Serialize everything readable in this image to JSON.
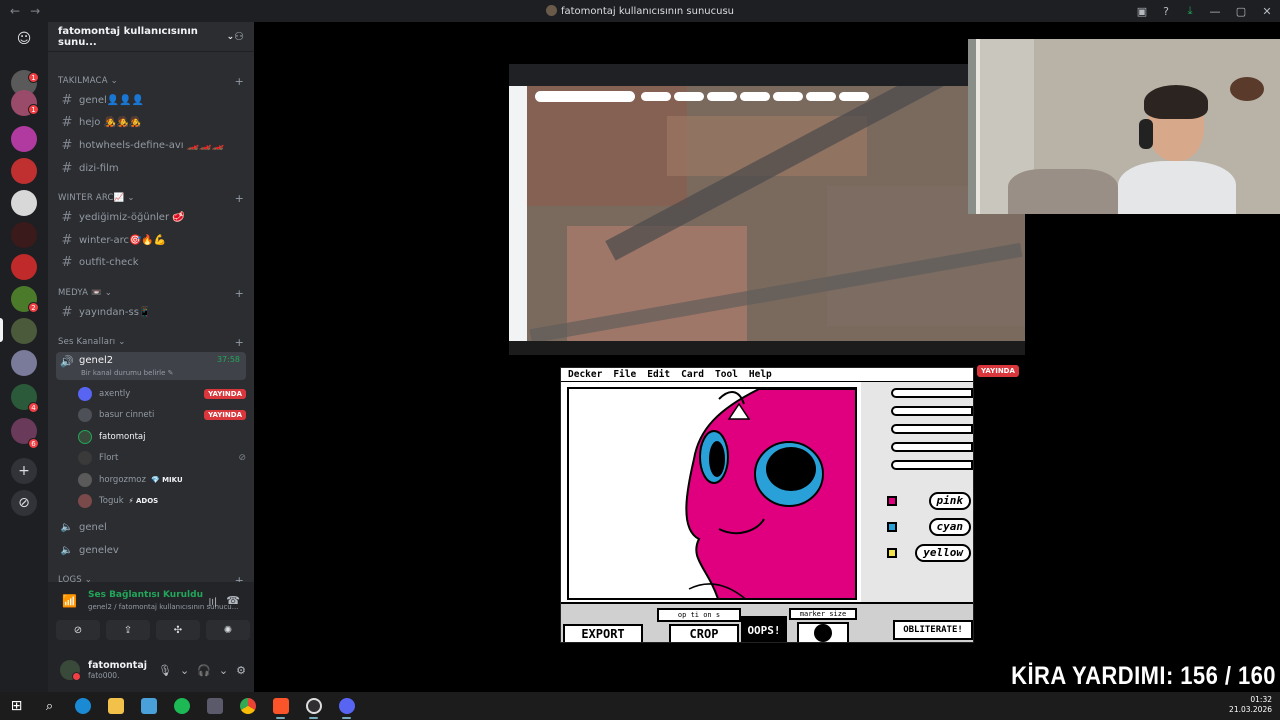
{
  "window": {
    "title": "fatomontaj kullanıcısının sunucusu",
    "nav_back": "←",
    "nav_forward": "→"
  },
  "server": {
    "name": "fatomontaj kullanıcısının sunu...",
    "badges": [
      "1",
      "1",
      "2",
      "4",
      "6"
    ]
  },
  "categories": [
    {
      "name": "TAKILMACA",
      "channels": [
        {
          "name": "genel👤👤👤"
        },
        {
          "name": "hejo 🧑‍🎤🧑‍🎤🧑‍🎤"
        },
        {
          "name": "hotwheels-define-avı 🏎️🏎️🏎️"
        },
        {
          "name": "dizi-film"
        }
      ]
    },
    {
      "name": "WINTER ARC📈",
      "channels": [
        {
          "name": "yediğimiz-öğünler 🥩"
        },
        {
          "name": "winter-arc🎯🔥💪"
        },
        {
          "name": "outfit-check"
        }
      ]
    },
    {
      "name": "MEDYA 📼",
      "channels": [
        {
          "name": "yayından-ss📱"
        }
      ]
    },
    {
      "name": "Ses Kanalları",
      "channels": []
    }
  ],
  "voice": {
    "active_channel": "genel2",
    "timer": "37:58",
    "status_prompt": "Bir kanal durumu belirle",
    "users": [
      {
        "name": "axently",
        "badge": "YAYINDA",
        "color": "#5865f2"
      },
      {
        "name": "basur cinneti",
        "badge": "YAYINDA",
        "color": "#4e5058"
      },
      {
        "name": "fatomontaj",
        "badge": "",
        "color": "#3a4a3a"
      },
      {
        "name": "Flort",
        "badge": "",
        "color": "#3a3a3a"
      },
      {
        "name": "horgozmoz",
        "badge": "",
        "tag": "💎 MIKU",
        "color": "#5a5a5a"
      },
      {
        "name": "Toguk",
        "badge": "",
        "tag": "⚡ ADOS",
        "color": "#7a4a4a"
      }
    ],
    "other_channels": [
      "genel",
      "genelev"
    ],
    "logs_category": "LOGS"
  },
  "voice_panel": {
    "status": "Ses Bağlantısı Kuruldu",
    "location": "genel2 / fatomontaj kullanıcısının sunucu..."
  },
  "me": {
    "display_name": "fatomontaj",
    "username": "fato000."
  },
  "stream_decker": {
    "menu": [
      "Decker",
      "File",
      "Edit",
      "Card",
      "Tool",
      "Help"
    ],
    "pens": [
      "pink",
      "cyan",
      "yellow"
    ],
    "pen_colors": [
      "#e0007f",
      "#2aa0d8",
      "#f2e24a"
    ],
    "buttons": {
      "export": "EXPORT",
      "options": "op ti on s",
      "crop": "CROP",
      "oops": "OOPS!",
      "marker_size": "marker size",
      "obliterate": "OBLITERATE!"
    }
  },
  "live_badge": "YAYINDA",
  "overlay_text": "KİRA YARDIMI:  156 / 160",
  "clock": {
    "time": "01:32",
    "date": "21.03.2026"
  }
}
